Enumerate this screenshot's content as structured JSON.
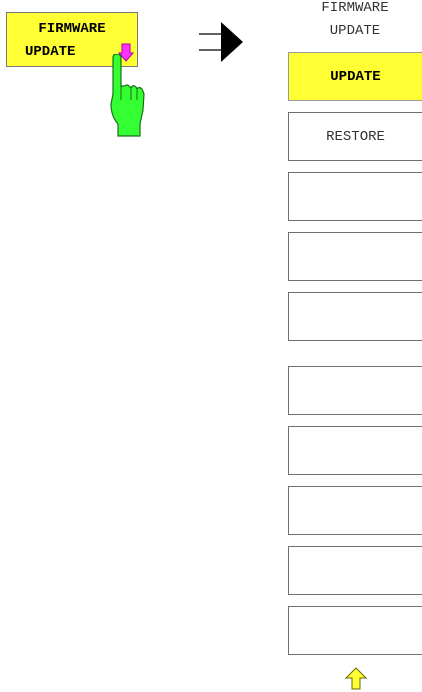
{
  "hardkey": {
    "label_line1": "FIRMWARE",
    "label_line2": "UPDATE",
    "icon": "arrow-down-icon",
    "color": "#ffff33"
  },
  "pointer": {
    "icon": "hand-icon",
    "color": "#33ff33"
  },
  "menu": {
    "title_line1": "FIRMWARE",
    "title_line2": "UPDATE",
    "softkeys": [
      {
        "label": "UPDATE",
        "active": true
      },
      {
        "label": "RESTORE",
        "active": false
      },
      {
        "label": "",
        "active": false
      },
      {
        "label": "",
        "active": false
      },
      {
        "label": "",
        "active": false
      },
      {
        "label": "",
        "active": false
      },
      {
        "label": "",
        "active": false
      },
      {
        "label": "",
        "active": false
      },
      {
        "label": "",
        "active": false
      },
      {
        "label": "",
        "active": false
      }
    ],
    "scroll_icon": "up-arrow-icon",
    "active_color": "#ffff33"
  }
}
